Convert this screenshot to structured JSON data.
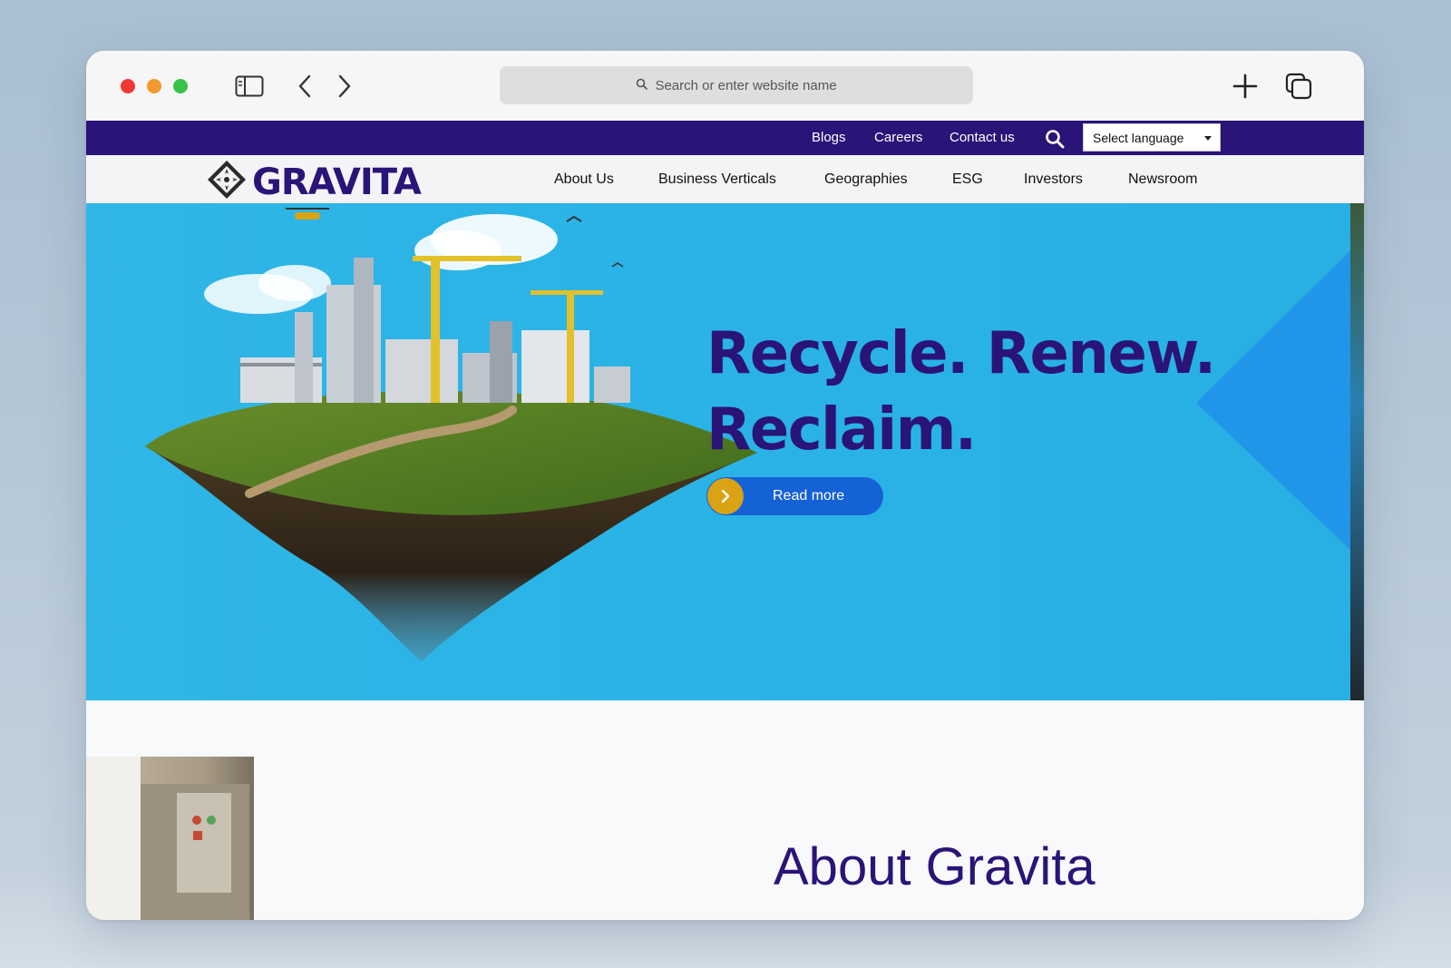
{
  "browser": {
    "address_placeholder": "Search or enter website name"
  },
  "utility_nav": {
    "links": [
      "Blogs",
      "Careers",
      "Contact us"
    ],
    "language_select": "Select language"
  },
  "site": {
    "logo_text": "GRAVITA",
    "nav": [
      "About Us",
      "Business Verticals",
      "Geographies",
      "ESG",
      "Investors",
      "Newsroom"
    ]
  },
  "hero": {
    "title_line1": "Recycle. Renew.",
    "title_line2": "Reclaim.",
    "cta": "Read more"
  },
  "about": {
    "title": "About Gravita"
  },
  "colors": {
    "brand": "#2a1477",
    "hero_bg": "#2ab3e6",
    "cta_blue": "#1561d6",
    "cta_gold": "#d9a313"
  }
}
